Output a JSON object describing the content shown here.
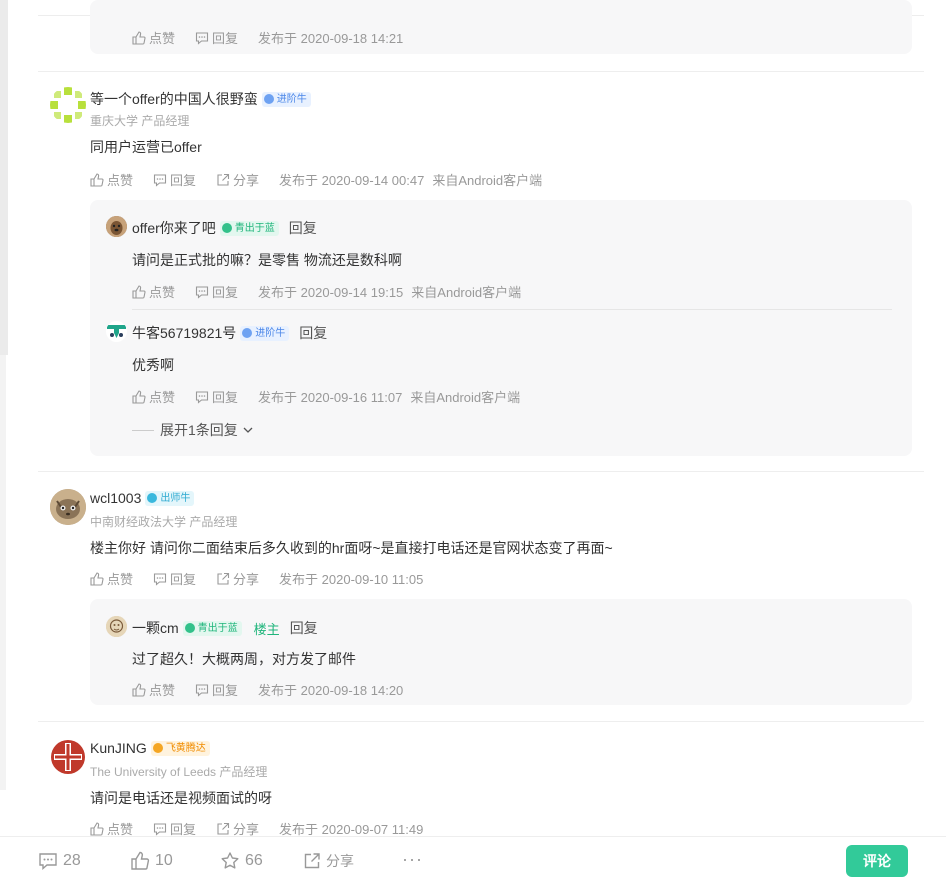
{
  "actions": {
    "like": "点赞",
    "reply": "回复",
    "share": "分享"
  },
  "top_reply": {
    "time": "发布于 2020-09-18 14:21"
  },
  "comments": [
    {
      "name": "等一个offer的中国人很野蛮",
      "badge": "进阶牛",
      "school": "重庆大学 产品经理",
      "content": "同用户运营已offer",
      "time": "发布于 2020-09-14 00:47",
      "source": "来自Android客户端",
      "replies": [
        {
          "name": "offer你来了吧",
          "badge": "青出于蓝",
          "reply_link": "回复",
          "content": "请问是正式批的嘛？是零售 物流还是数科啊",
          "time": "发布于 2020-09-14 19:15",
          "source": "来自Android客户端"
        },
        {
          "name": "牛客56719821号",
          "badge": "进阶牛",
          "reply_link": "回复",
          "content": "优秀啊",
          "time": "发布于 2020-09-16 11:07",
          "source": "来自Android客户端"
        }
      ],
      "expand": "展开1条回复"
    },
    {
      "name": "wcl1003",
      "badge": "出师牛",
      "school": "中南财经政法大学 产品经理",
      "content": "楼主你好 请问你二面结束后多久收到的hr面呀~是直接打电话还是官网状态变了再面~",
      "time": "发布于 2020-09-10 11:05",
      "replies": [
        {
          "name": "一颗cm",
          "badge": "青出于蓝",
          "tag": "楼主",
          "reply_link": "回复",
          "content": "过了超久！大概两周，对方发了邮件",
          "time": "发布于 2020-09-18 14:20"
        }
      ]
    },
    {
      "name": "KunJING",
      "badge": "飞黄腾达",
      "school": "The University of Leeds 产品经理",
      "content": "请问是电话还是视频面试的呀",
      "time": "发布于 2020-09-07 11:49"
    }
  ],
  "bottom_bar": {
    "comments": "28",
    "likes": "10",
    "favorites": "66",
    "share": "分享",
    "more": "···",
    "comment_button": "评论"
  },
  "colors": {
    "accent": "#32ca99",
    "badge_blue": "#4a86e8",
    "badge_green": "#1fb57b",
    "badge_orange": "#f08c00"
  }
}
